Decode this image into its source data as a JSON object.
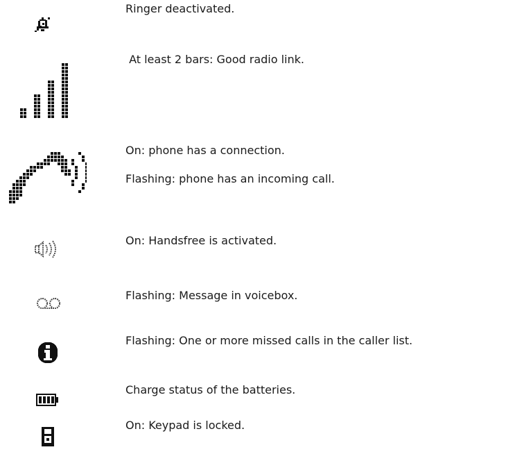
{
  "entries": [
    {
      "icon": "ringer-off-icon",
      "texts": [
        "Ringer deactivated."
      ]
    },
    {
      "icon": "signal-bars-icon",
      "texts": [
        " At least 2 bars: Good radio link."
      ]
    },
    {
      "icon": "phone-connection-icon",
      "texts": [
        "On: phone has a connection.",
        "Flashing: phone has an incoming call."
      ]
    },
    {
      "icon": "handsfree-icon",
      "texts": [
        "On: Handsfree is activated."
      ]
    },
    {
      "icon": "voicemail-icon",
      "texts": [
        "Flashing: Message in voicebox."
      ]
    },
    {
      "icon": "info-icon",
      "texts": [
        "Flashing: One or more missed calls in the caller list."
      ]
    },
    {
      "icon": "battery-icon",
      "texts": [
        "Charge status of the batteries."
      ]
    },
    {
      "icon": "keypad-lock-icon",
      "texts": [
        "On: Keypad is locked."
      ]
    }
  ]
}
